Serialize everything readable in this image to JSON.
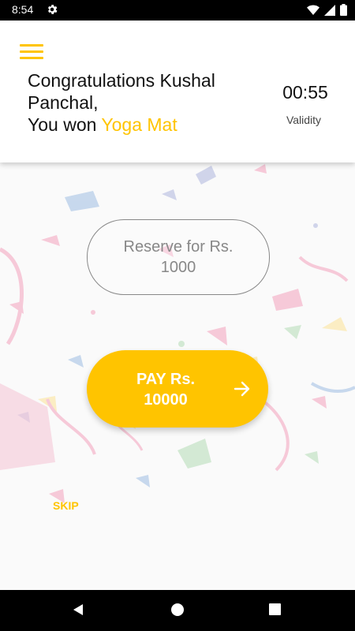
{
  "status_bar": {
    "time": "8:54",
    "icons": [
      "settings-icon",
      "wifi-icon",
      "signal-icon",
      "battery-icon"
    ]
  },
  "header": {
    "menu_icon": "hamburger-menu-icon",
    "greeting_line1": "Congratulations Kushal",
    "greeting_line2": "Panchal,",
    "you_won": "You won ",
    "prize": "Yoga Mat",
    "timer": "00:55",
    "timer_label": "Validity"
  },
  "reserve_button": {
    "line1": "Reserve for Rs.",
    "line2": "1000"
  },
  "pay_button": {
    "line1": "PAY Rs.",
    "line2": "10000",
    "icon": "arrow-right-icon"
  },
  "skip_label": "SKIP",
  "nav_bar": {
    "icons": [
      "back-icon",
      "home-icon",
      "recents-icon"
    ]
  },
  "colors": {
    "accent": "#FFC400",
    "status_bar": "#000000",
    "background": "#FAFAFA"
  }
}
